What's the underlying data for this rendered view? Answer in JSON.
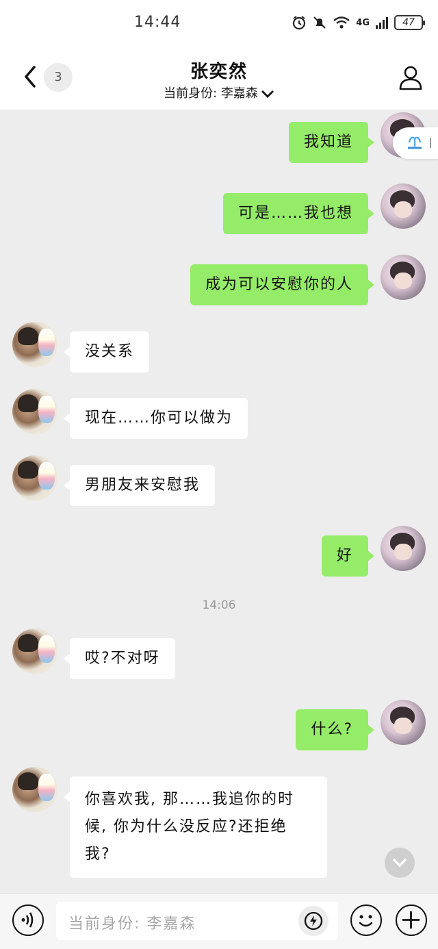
{
  "status_bar": {
    "time": "14:44",
    "battery": "47",
    "signal_label": "4G"
  },
  "header": {
    "title": "张奕然",
    "identity": "当前身份: 李嘉森",
    "unread_count": "3"
  },
  "messages": [
    {
      "from": "me",
      "text": "我知道"
    },
    {
      "from": "me",
      "text": "可是……我也想"
    },
    {
      "from": "me",
      "text": "成为可以安慰你的人"
    },
    {
      "from": "other",
      "text": "没关系"
    },
    {
      "from": "other",
      "text": "现在……你可以做为"
    },
    {
      "from": "other",
      "text": "男朋友来安慰我"
    },
    {
      "from": "me",
      "text": "好"
    },
    {
      "from": "other",
      "text": "哎?不对呀"
    },
    {
      "from": "me",
      "text": "什么?"
    },
    {
      "from": "other",
      "lines": [
        "你喜欢我, 那……我追你的时",
        "候, 你为什么没反应?还拒绝",
        "我?"
      ]
    }
  ],
  "timestamp": "14:06",
  "input": {
    "placeholder": "当前身份: 李嘉森"
  },
  "colors": {
    "me_bubble": "#95ec69",
    "other_bubble": "#ffffff",
    "background": "#ededed"
  },
  "icons": [
    "back-arrow-icon",
    "person-icon",
    "chevron-down-icon",
    "voice-icon",
    "spark-icon",
    "emoji-icon",
    "plus-icon",
    "alarm-icon",
    "mute-icon",
    "wifi-icon",
    "signal-icon",
    "battery-icon",
    "fountain-icon",
    "scroll-down-icon"
  ]
}
